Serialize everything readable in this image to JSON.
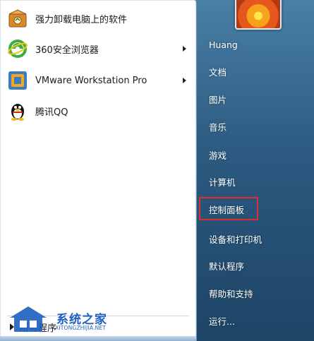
{
  "programs": [
    {
      "label": "强力卸载电脑上的软件",
      "icon": "uninstall-box-icon",
      "has_submenu": false
    },
    {
      "label": "360安全浏览器",
      "icon": "360-browser-icon",
      "has_submenu": true
    },
    {
      "label": "VMware Workstation Pro",
      "icon": "vmware-icon",
      "has_submenu": true
    },
    {
      "label": "腾讯QQ",
      "icon": "qq-penguin-icon",
      "has_submenu": false
    }
  ],
  "all_programs": {
    "label": "所有程序"
  },
  "right_menu": {
    "items": [
      {
        "label": "Huang"
      },
      {
        "label": "文档"
      },
      {
        "label": "图片"
      },
      {
        "label": "音乐"
      },
      {
        "label": "游戏"
      },
      {
        "label": "计算机"
      },
      {
        "label": "控制面板"
      },
      {
        "label": "设备和打印机"
      },
      {
        "label": "默认程序"
      },
      {
        "label": "帮助和支持"
      },
      {
        "label": "运行..."
      }
    ]
  },
  "highlight": {
    "target": "控制面板",
    "color": "#e02c2c"
  },
  "watermark": {
    "title": "系统之家",
    "url": "XITONGZHIJIA.NET"
  }
}
